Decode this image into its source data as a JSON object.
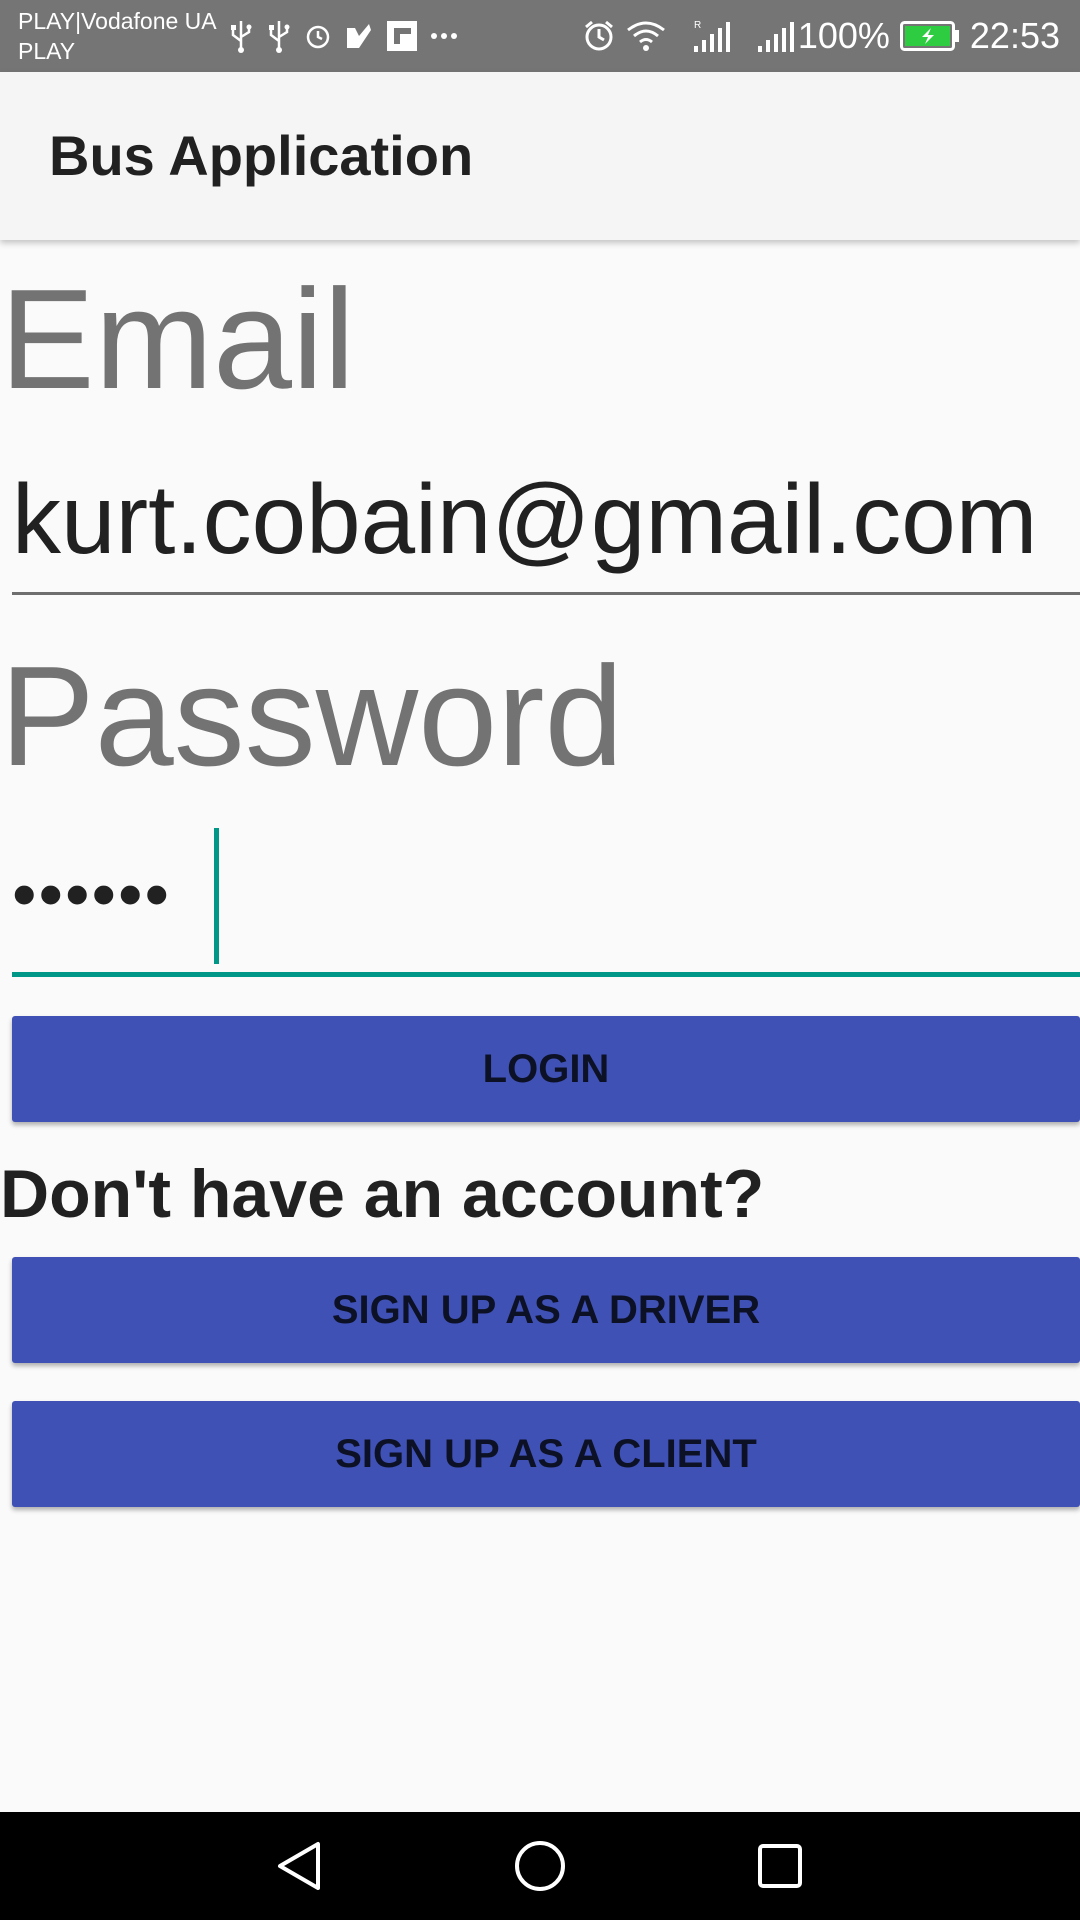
{
  "status_bar": {
    "carrier_line1": "PLAY|Vodafone UA",
    "carrier_line2": "PLAY",
    "icons_left": [
      "usb-icon",
      "usb-icon",
      "alarm-icon",
      "check-icon",
      "flipboard-icon",
      "more-icon"
    ],
    "icons_right": [
      "alarm-icon",
      "wifi-icon",
      "signal-roaming-icon",
      "signal-icon",
      "battery-charging-icon"
    ],
    "battery": "100%",
    "time": "22:53"
  },
  "app_bar": {
    "title": "Bus Application"
  },
  "form": {
    "email_label": "Email",
    "email_value": "kurt.cobain@gmail.com",
    "password_label": "Password",
    "password_value": "••••••"
  },
  "buttons": {
    "login": "LOGIN",
    "no_account": "Don't have an account?",
    "signup_driver": "SIGN UP AS A DRIVER",
    "signup_client": "SIGN UP AS A CLIENT"
  },
  "nav_bar": {
    "icons": [
      "back-icon",
      "home-icon",
      "recents-icon"
    ]
  },
  "colors": {
    "primary": "#3f51b5",
    "accent": "#009688",
    "status_bar": "#757575",
    "battery": "#2ecc40"
  }
}
